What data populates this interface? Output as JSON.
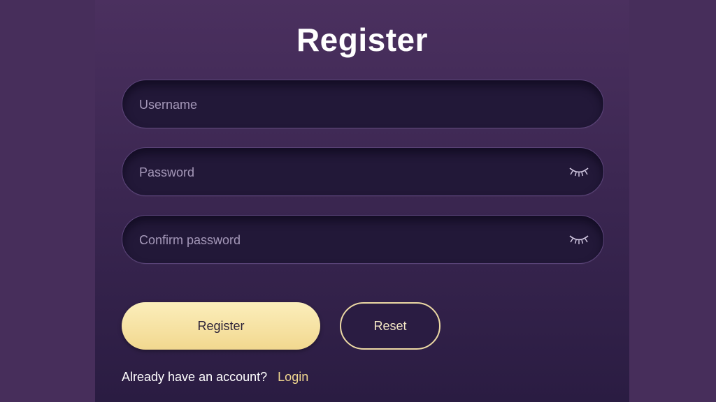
{
  "form": {
    "title": "Register",
    "fields": {
      "username": {
        "placeholder": "Username",
        "value": ""
      },
      "password": {
        "placeholder": "Password",
        "value": "",
        "toggle_icon": "eye-closed-icon"
      },
      "confirm_password": {
        "placeholder": "Confirm password",
        "value": "",
        "toggle_icon": "eye-closed-icon"
      }
    },
    "buttons": {
      "register_label": "Register",
      "reset_label": "Reset"
    },
    "footer": {
      "prompt": "Already have an account?",
      "login_label": "Login"
    }
  },
  "colors": {
    "background": "#472e5b",
    "accent": "#f2d88f",
    "field": "#221838"
  }
}
